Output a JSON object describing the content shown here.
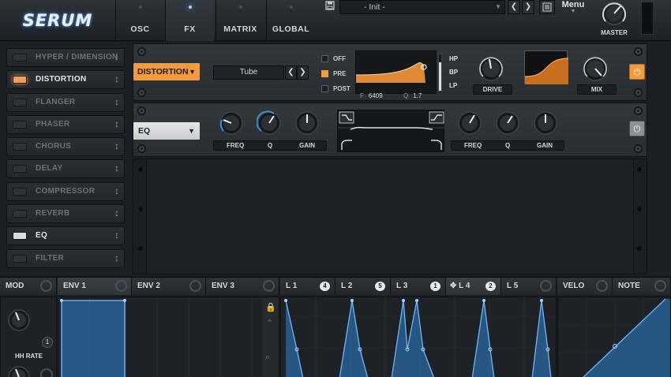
{
  "logo": "SERUM",
  "main_tabs": [
    {
      "label": "OSC",
      "active": false
    },
    {
      "label": "FX",
      "active": true
    },
    {
      "label": "MATRIX",
      "active": false
    },
    {
      "label": "GLOBAL",
      "active": false
    }
  ],
  "preset": {
    "name": "- Init -",
    "menu_label": "Menu"
  },
  "master": {
    "label": "MASTER"
  },
  "fx_list": [
    {
      "name": "HYPER / DIMENSION",
      "on": false
    },
    {
      "name": "DISTORTION",
      "on": true,
      "accent": "orange"
    },
    {
      "name": "FLANGER",
      "on": false
    },
    {
      "name": "PHASER",
      "on": false
    },
    {
      "name": "CHORUS",
      "on": false
    },
    {
      "name": "DELAY",
      "on": false
    },
    {
      "name": "COMPRESSOR",
      "on": false
    },
    {
      "name": "REVERB",
      "on": false
    },
    {
      "name": "EQ",
      "on": true,
      "accent": "white"
    },
    {
      "name": "FILTER",
      "on": false
    }
  ],
  "distortion": {
    "type": "DISTORTION",
    "mode": "Tube",
    "prepost": [
      {
        "label": "OFF",
        "checked": false
      },
      {
        "label": "PRE",
        "checked": true
      },
      {
        "label": "POST",
        "checked": false
      }
    ],
    "filter_types": [
      "HP",
      "BP",
      "LP"
    ],
    "freq_label": "F",
    "freq_value": "6409",
    "q_label": "Q",
    "q_value": "1.7",
    "drive_label": "DRIVE",
    "mix_label": "MIX"
  },
  "eq": {
    "type": "EQ",
    "left": {
      "freq": "FREQ",
      "q": "Q",
      "gain": "GAIN"
    },
    "right": {
      "freq": "FREQ",
      "q": "Q",
      "gain": "GAIN"
    }
  },
  "mod": {
    "mod_label": "MOD",
    "hh_label": "HH RATE",
    "hh_value": "1",
    "env_tabs": [
      "ENV 1",
      "ENV 2",
      "ENV 3"
    ],
    "lfo_tabs": [
      {
        "label": "L 1",
        "count": "4"
      },
      {
        "label": "L 2",
        "count": "5"
      },
      {
        "label": "L 3",
        "count": "1"
      },
      {
        "label": "L 4",
        "count": "2"
      },
      {
        "label": "L 5",
        "count": ""
      }
    ],
    "velo_label": "VELO",
    "note_label": "NOTE"
  },
  "colors": {
    "accent_orange": "#f19a3e",
    "mod_blue": "#3b8fd6",
    "led_blue": "#9cd3ff"
  },
  "icons": [
    "save-icon",
    "chevron-left-icon",
    "chevron-right-icon",
    "browser-icon",
    "drag-handle-icon",
    "power-icon",
    "lock-icon",
    "move-icon"
  ]
}
